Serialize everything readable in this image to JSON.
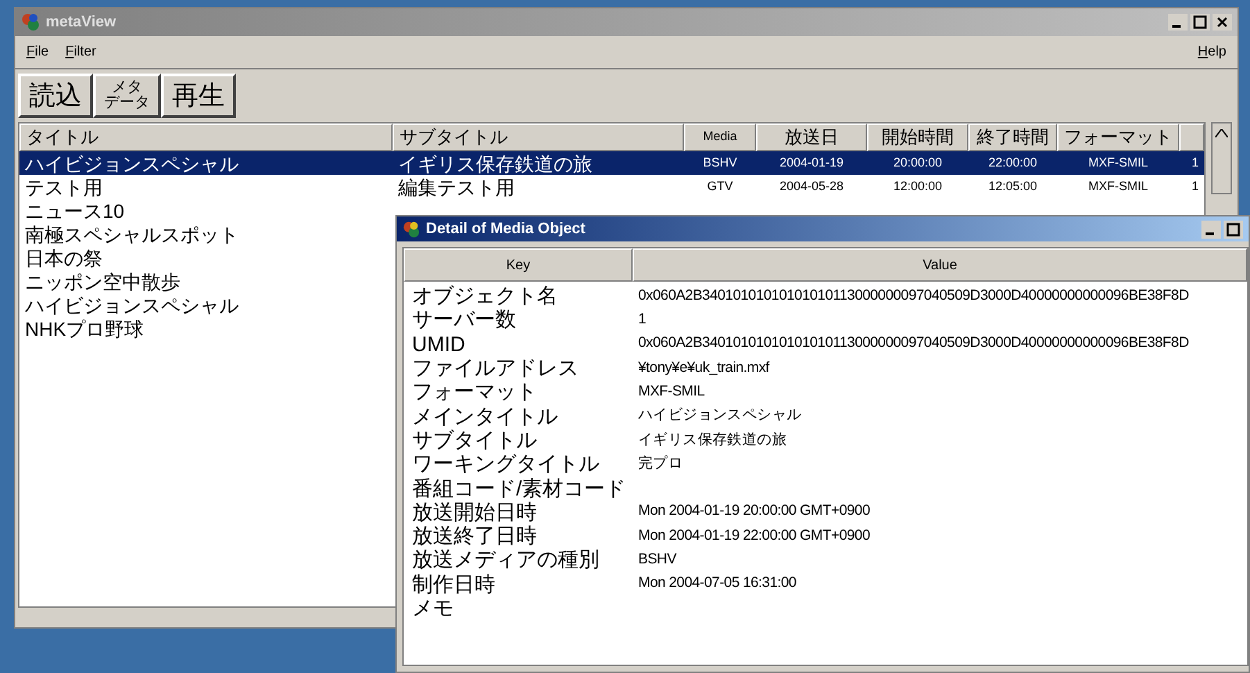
{
  "main_window": {
    "title": "metaView",
    "menu": [
      {
        "label": "File"
      },
      {
        "label": "Filter"
      }
    ],
    "help_menu": {
      "label": "Help"
    },
    "toolbar": [
      {
        "lines": [
          "読込"
        ]
      },
      {
        "lines": [
          "メタ",
          "データ"
        ]
      },
      {
        "lines": [
          "再生"
        ]
      }
    ],
    "table": {
      "columns": [
        "タイトル",
        "サブタイトル",
        "Media",
        "放送日",
        "開始時間",
        "終了時間",
        "フォーマット"
      ],
      "rows": [
        {
          "selected": true,
          "cells": [
            "ハイビジョンスペシャル",
            "イギリス保存鉄道の旅",
            "BSHV",
            "2004-01-19",
            "20:00:00",
            "22:00:00",
            "MXF-SMIL",
            "1"
          ]
        },
        {
          "selected": false,
          "cells": [
            "テスト用",
            "編集テスト用",
            "GTV",
            "2004-05-28",
            "12:00:00",
            "12:05:00",
            "MXF-SMIL",
            "1"
          ]
        },
        {
          "selected": false,
          "cells": [
            "ニュース10"
          ]
        },
        {
          "selected": false,
          "cells": [
            "南極スペシャルスポット"
          ]
        },
        {
          "selected": false,
          "cells": [
            "日本の祭"
          ]
        },
        {
          "selected": false,
          "cells": [
            "ニッポン空中散歩"
          ]
        },
        {
          "selected": false,
          "cells": [
            "ハイビジョンスペシャル"
          ]
        },
        {
          "selected": false,
          "cells": [
            "NHKプロ野球"
          ]
        }
      ]
    }
  },
  "detail_window": {
    "title": "Detail of Media Object",
    "columns": [
      "Key",
      "Value"
    ],
    "rows": [
      {
        "key": "オブジェクト名",
        "value": "0x060A2B34010101010101010113000000097040509D3000D40000000000096BE38F8D"
      },
      {
        "key": "サーバー数",
        "value": "1"
      },
      {
        "key": "UMID",
        "value": "0x060A2B34010101010101010113000000097040509D3000D40000000000096BE38F8D"
      },
      {
        "key": "ファイルアドレス",
        "value": "¥tony¥e¥uk_train.mxf"
      },
      {
        "key": "フォーマット",
        "value": "MXF-SMIL"
      },
      {
        "key": "メインタイトル",
        "value": "ハイビジョンスペシャル"
      },
      {
        "key": "サブタイトル",
        "value": "イギリス保存鉄道の旅"
      },
      {
        "key": "ワーキングタイトル",
        "value": "完プロ"
      },
      {
        "key": "番組コード/素材コード"
      },
      {
        "key": "放送開始日時",
        "value": "Mon 2004-01-19 20:00:00 GMT+0900"
      },
      {
        "key": "放送終了日時",
        "value": "Mon 2004-01-19 22:00:00 GMT+0900"
      },
      {
        "key": "放送メディアの種別",
        "value": "BSHV"
      },
      {
        "key": "制作日時",
        "value": "Mon 2004-07-05 16:31:00"
      },
      {
        "key": "メモ"
      }
    ]
  }
}
